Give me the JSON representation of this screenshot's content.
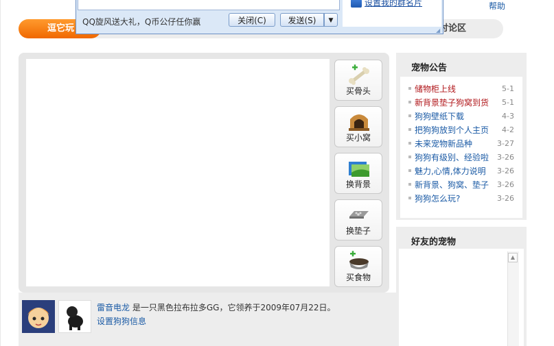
{
  "header": {
    "help_label": "帮助",
    "tabs": [
      {
        "label": "逗它玩",
        "active": true
      },
      {
        "label": "讨论区",
        "active": false
      }
    ]
  },
  "chat_popup": {
    "side_link": "设置我的群名片",
    "promo_text": "QQ旋风送大礼，Q币公仔任你赢",
    "close_label": "关闭(C)",
    "send_label": "发送(S)",
    "send_arrow": "▼"
  },
  "tools": [
    {
      "label": "买骨头",
      "icon": "bone-icon"
    },
    {
      "label": "买小窝",
      "icon": "doghouse-icon"
    },
    {
      "label": "换背景",
      "icon": "background-icon"
    },
    {
      "label": "换垫子",
      "icon": "mat-icon"
    },
    {
      "label": "买食物",
      "icon": "food-bowl-icon"
    }
  ],
  "pet_info": {
    "owner": "雷音电龙",
    "description": "是一只黑色拉布拉多GG，它领养于2009年07月22日。",
    "settings_link": "设置狗狗信息"
  },
  "notice": {
    "title": "宠物公告",
    "items": [
      {
        "text": "储物柜上线",
        "date": "5-1",
        "color": "red"
      },
      {
        "text": "新背景垫子狗窝到货",
        "date": "5-1",
        "color": "red"
      },
      {
        "text": "狗狗壁纸下载",
        "date": "4-3",
        "color": "blue"
      },
      {
        "text": "把狗狗放到个人主页",
        "date": "4-2",
        "color": "blue"
      },
      {
        "text": "未来宠物新品种",
        "date": "3-27",
        "color": "blue"
      },
      {
        "text": "狗狗有级别、经验啦",
        "date": "3-26",
        "color": "blue"
      },
      {
        "text": "魅力,心情,体力说明",
        "date": "3-26",
        "color": "blue"
      },
      {
        "text": "新背景、狗窝、垫子",
        "date": "3-26",
        "color": "blue"
      },
      {
        "text": "狗狗怎么玩?",
        "date": "3-26",
        "color": "blue"
      }
    ]
  },
  "friends": {
    "title": "好友的宠物"
  },
  "colors": {
    "accent_orange": "#f06800",
    "link_blue": "#1a5aa5",
    "notice_red": "#b0161a"
  }
}
